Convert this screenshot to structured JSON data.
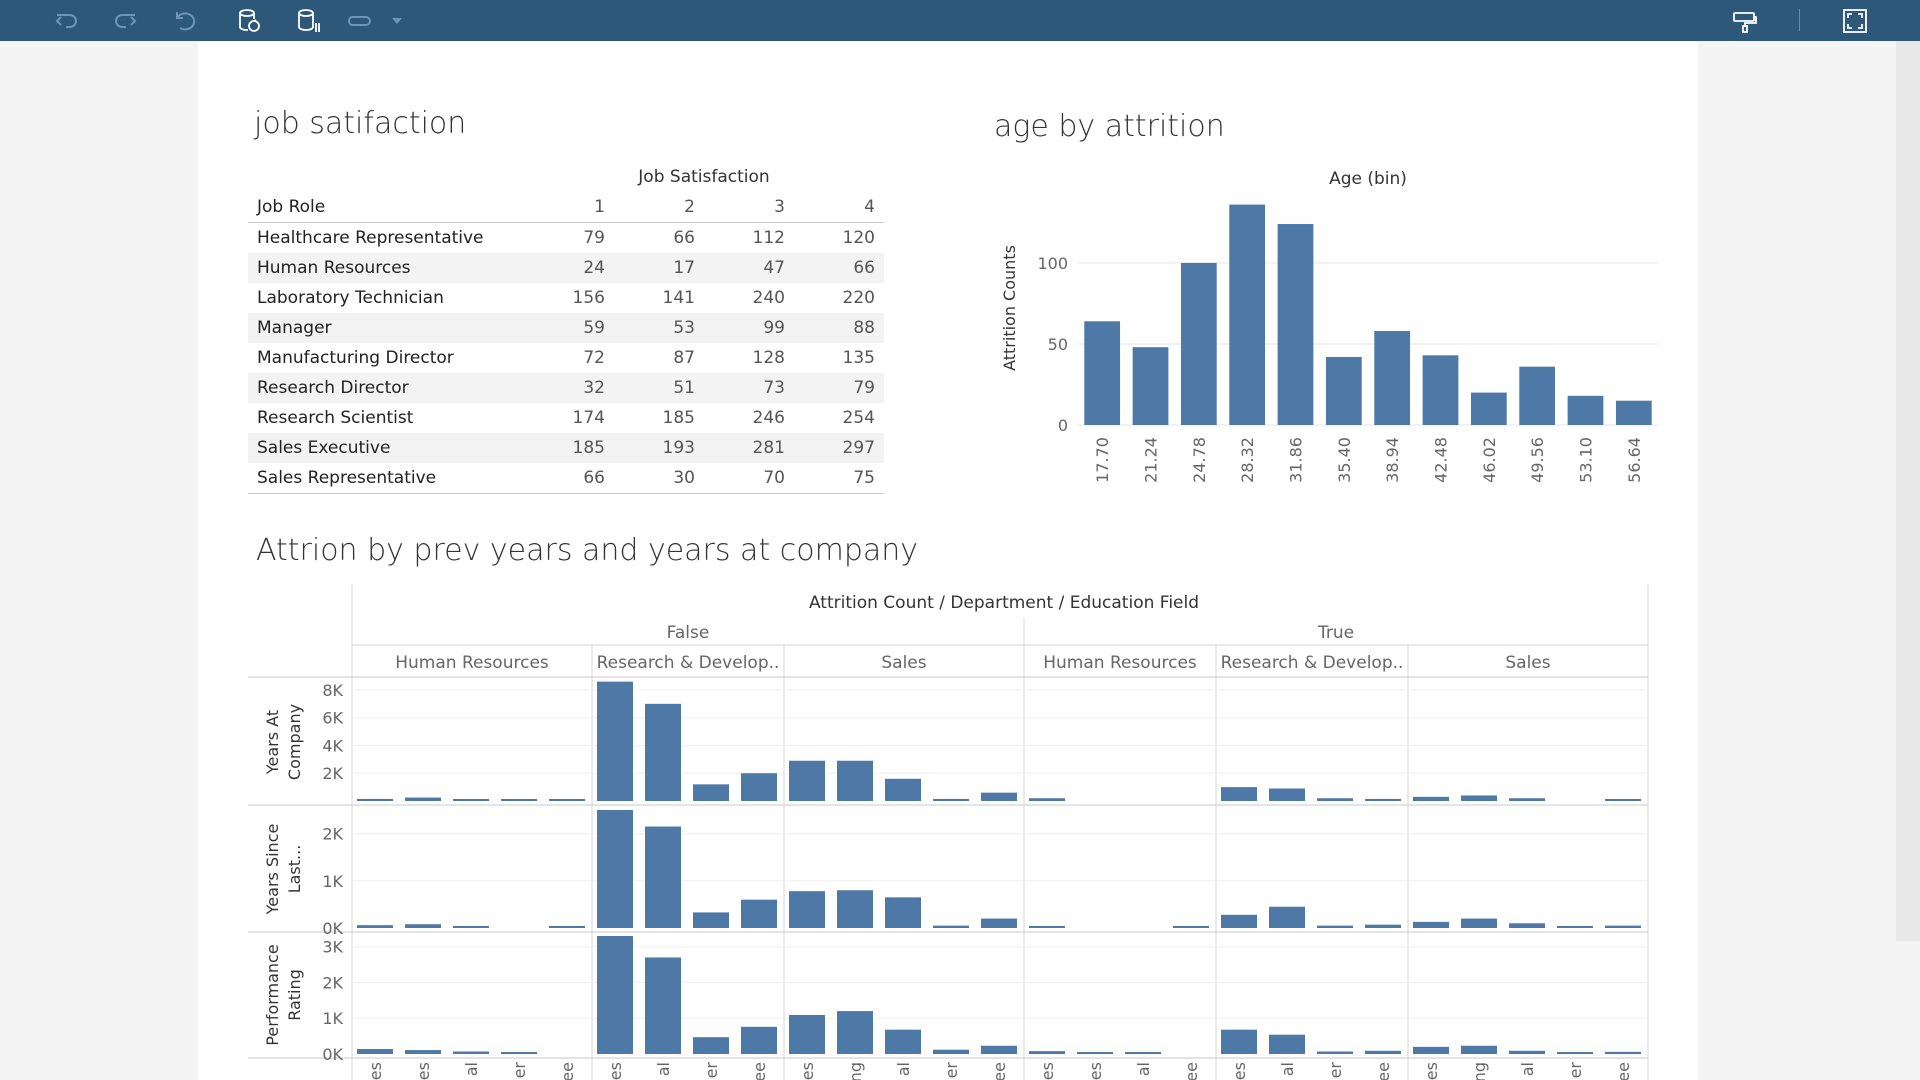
{
  "toolbar": {
    "icons": [
      "undo-icon",
      "redo-icon",
      "revert-icon",
      "refresh-data-icon",
      "pause-updates-icon",
      "show-me-icon",
      "dropdown-caret-icon",
      "present-mode-icon",
      "fit-screen-icon"
    ]
  },
  "job_satisfaction": {
    "title": "job satifaction",
    "column_header": "Job Satisfaction",
    "row_header": "Job Role",
    "columns": [
      "1",
      "2",
      "3",
      "4"
    ],
    "rows": [
      {
        "role": "Healthcare Representative",
        "values": [
          "79",
          "66",
          "112",
          "120"
        ]
      },
      {
        "role": "Human Resources",
        "values": [
          "24",
          "17",
          "47",
          "66"
        ]
      },
      {
        "role": "Laboratory Technician",
        "values": [
          "156",
          "141",
          "240",
          "220"
        ]
      },
      {
        "role": "Manager",
        "values": [
          "59",
          "53",
          "99",
          "88"
        ]
      },
      {
        "role": "Manufacturing Director",
        "values": [
          "72",
          "87",
          "128",
          "135"
        ]
      },
      {
        "role": "Research Director",
        "values": [
          "32",
          "51",
          "73",
          "79"
        ]
      },
      {
        "role": "Research Scientist",
        "values": [
          "174",
          "185",
          "246",
          "254"
        ]
      },
      {
        "role": "Sales Executive",
        "values": [
          "185",
          "193",
          "281",
          "297"
        ]
      },
      {
        "role": "Sales Representative",
        "values": [
          "66",
          "30",
          "70",
          "75"
        ]
      }
    ]
  },
  "age_by_attrition": {
    "title": "age by attrition"
  },
  "attrition_prev": {
    "title": "Attrion by prev years and years at company"
  },
  "colors": {
    "bar": "#4e79a7",
    "toolbar": "#2d5879",
    "grid": "#e6e6e6"
  },
  "chart_data": [
    {
      "type": "bar",
      "title": "Age (bin)",
      "ylabel": "Attrition Counts",
      "categories": [
        "17.70",
        "21.24",
        "24.78",
        "28.32",
        "31.86",
        "35.40",
        "38.94",
        "42.48",
        "46.02",
        "49.56",
        "53.10",
        "56.64"
      ],
      "values": [
        64,
        48,
        100,
        136,
        124,
        42,
        58,
        43,
        20,
        36,
        18,
        15
      ],
      "yticks": [
        "0",
        "50",
        "100"
      ],
      "ylim": [
        0,
        145
      ],
      "grid": true
    },
    {
      "type": "bar",
      "title": "Attrition Count / Department / Education Field",
      "column_groups": [
        {
          "label": "False",
          "departments": [
            {
              "label": "Human Resources",
              "n": 5
            },
            {
              "label": "Research & Develop..",
              "n": 4
            },
            {
              "label": "Sales",
              "n": 5
            }
          ]
        },
        {
          "label": "True",
          "departments": [
            {
              "label": "Human Resources",
              "n": 4
            },
            {
              "label": "Research & Develop..",
              "n": 4
            },
            {
              "label": "Sales",
              "n": 5
            }
          ]
        }
      ],
      "x_tick_fragments": [
        "es",
        "es",
        "al",
        "er",
        "ee",
        "es",
        "al",
        "er",
        "ee",
        "es",
        "ng",
        "al",
        "er",
        "ee",
        "es",
        "es",
        "al",
        "ee",
        "es",
        "al",
        "er",
        "ee",
        "es",
        "ng",
        "al",
        "er",
        "ee"
      ],
      "rows": [
        {
          "label_lines": [
            "Years At",
            "Company"
          ],
          "max": 8500,
          "ticks": [
            {
              "v": 2000,
              "t": "2K"
            },
            {
              "v": 4000,
              "t": "4K"
            },
            {
              "v": 6000,
              "t": "6K"
            },
            {
              "v": 8000,
              "t": "8K"
            }
          ],
          "values": [
            150,
            250,
            80,
            80,
            80,
            8600,
            7000,
            1200,
            2000,
            2900,
            2900,
            1600,
            150,
            600,
            200,
            0,
            0,
            0,
            1000,
            900,
            200,
            150,
            300,
            400,
            200,
            0,
            100
          ]
        },
        {
          "label_lines": [
            "Years Since",
            "Last..."
          ],
          "max": 2500,
          "ticks": [
            {
              "v": 0,
              "t": "0K"
            },
            {
              "v": 1000,
              "t": "1K"
            },
            {
              "v": 2000,
              "t": "2K"
            }
          ],
          "values": [
            60,
            80,
            40,
            0,
            30,
            2500,
            2150,
            330,
            600,
            780,
            800,
            650,
            50,
            200,
            30,
            0,
            0,
            30,
            280,
            450,
            50,
            70,
            130,
            200,
            100,
            30,
            50
          ]
        },
        {
          "label_lines": [
            "Performance",
            "Rating"
          ],
          "max": 3300,
          "ticks": [
            {
              "v": 0,
              "t": "0K"
            },
            {
              "v": 1000,
              "t": "1K"
            },
            {
              "v": 2000,
              "t": "2K"
            },
            {
              "v": 3000,
              "t": "3K"
            }
          ],
          "values": [
            140,
            110,
            70,
            50,
            0,
            3300,
            2700,
            470,
            760,
            1090,
            1200,
            680,
            120,
            230,
            80,
            40,
            40,
            0,
            680,
            540,
            70,
            90,
            200,
            230,
            90,
            50,
            60
          ]
        }
      ]
    }
  ]
}
